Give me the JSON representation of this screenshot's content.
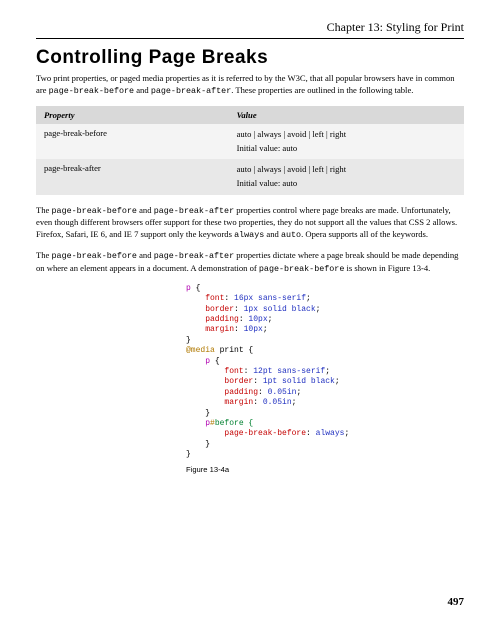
{
  "chapter": "Chapter 13: Styling for Print",
  "heading": "Controlling Page Breaks",
  "para1": {
    "t1": "Two print properties, or paged media properties as it is referred to by the W3C, that all popular browsers have in common are ",
    "c1": "page-break-before",
    "t2": " and ",
    "c2": "page-break-after",
    "t3": ". These properties are outlined in the following table."
  },
  "table": {
    "h_prop": "Property",
    "h_val": "Value",
    "rows": [
      {
        "prop": "page-break-before",
        "opts": "auto | always | avoid | left | right",
        "init": "Initial value: auto"
      },
      {
        "prop": "page-break-after",
        "opts": "auto | always | avoid | left | right",
        "init": "Initial value: auto"
      }
    ]
  },
  "para2": {
    "t1": "The ",
    "c1": "page-break-before",
    "t2": " and ",
    "c2": "page-break-after",
    "t3": " properties control where page breaks are made. Unfortunately, even though different browsers offer support for these two properties, they do not support all the values that CSS 2 allows. Firefox, Safari, IE 6, and IE 7 support only the keywords ",
    "c3": "always",
    "t4": " and ",
    "c4": "auto",
    "t5": ". Opera supports all of the keywords."
  },
  "para3": {
    "t1": "The ",
    "c1": "page-break-before",
    "t2": " and ",
    "c2": "page-break-after",
    "t3": " properties dictate where a page break should be made depending on where an element appears in a document. A demonstration of ",
    "c3": "page-break-before",
    "t4": " is shown in Figure 13-4."
  },
  "code": {
    "sel_p": "p",
    "brace_open": " {",
    "prop_font": "font",
    "colon": ": ",
    "val_font1": "16px sans-serif",
    "semi": ";",
    "prop_border": "border",
    "val_border1": "1px solid black",
    "prop_padding": "padding",
    "val_padding1": "10px",
    "prop_margin": "margin",
    "val_margin1": "10px",
    "brace_close": "}",
    "at_media": "@media",
    "media_val": " print {",
    "val_font2": "12pt sans-serif",
    "val_border2": "1pt solid black",
    "val_padding2": "0.05in",
    "val_margin2": "0.05in",
    "pseudo_hash": "#",
    "pseudo_before": "before {",
    "prop_pbb": "page-break-before",
    "val_pbb": "always"
  },
  "figure_label": "Figure 13-4a",
  "page_number": "497"
}
